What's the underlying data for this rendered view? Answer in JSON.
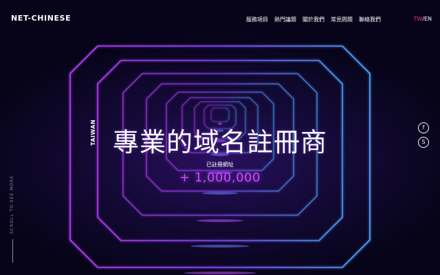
{
  "header": {
    "logo": "NET-CHINESE",
    "nav": [
      "服務項目",
      "熱門議題",
      "關於我們",
      "常見問題",
      "聯絡我們"
    ],
    "lang": {
      "active": "TW",
      "separator": "/",
      "other": "EN"
    }
  },
  "hero": {
    "side_label": "TAIWAN",
    "headline": "專業的域名註冊商",
    "registered_label": "已註冊網址",
    "registered_count": "+ 1,000,000"
  },
  "social": [
    {
      "name": "facebook-icon",
      "glyph": "f"
    },
    {
      "name": "skype-icon",
      "glyph": "S"
    }
  ],
  "scroll_hint": "SCROLL TO SEE MORE",
  "colors": {
    "accent": "#d04aff",
    "lang_active": "#e0357a",
    "background": "#0a0520"
  }
}
